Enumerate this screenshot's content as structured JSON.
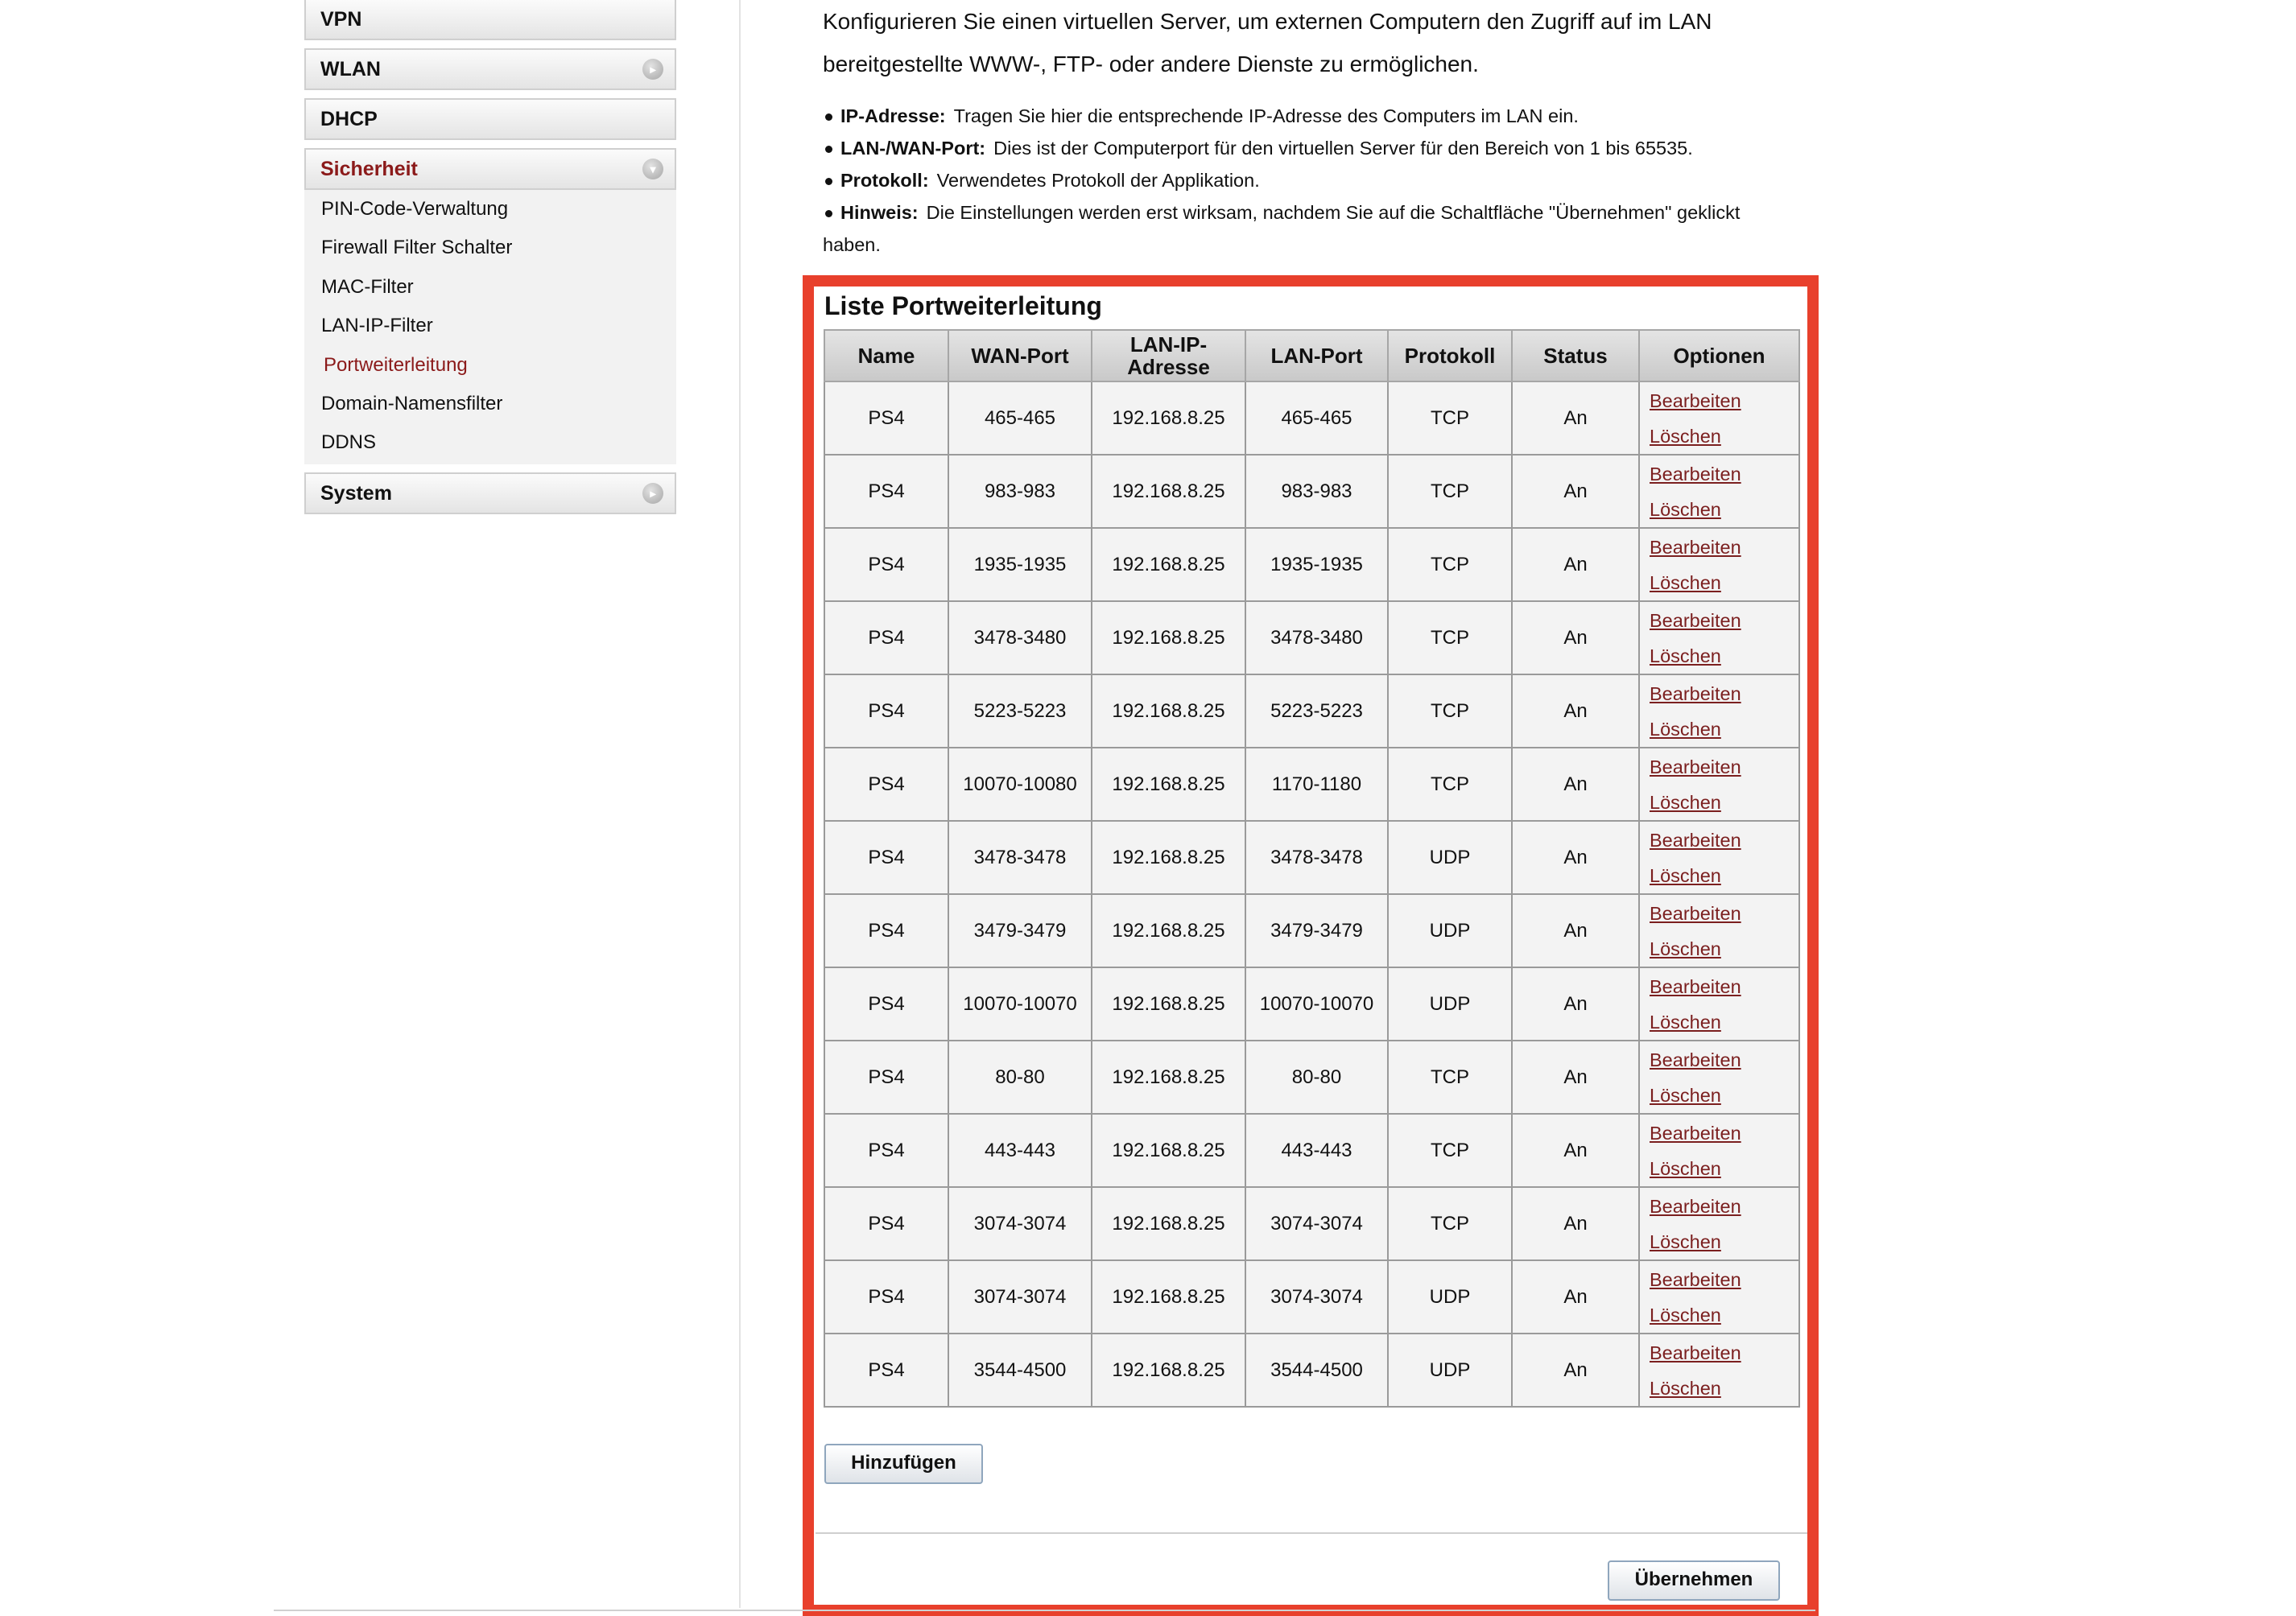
{
  "sidebar": {
    "sections": [
      {
        "label": "VPN"
      },
      {
        "label": "WLAN",
        "icon": "circle-chevron-right-icon"
      },
      {
        "label": "DHCP"
      },
      {
        "label": "Sicherheit",
        "icon": "circle-chevron-down-icon",
        "expanded": true,
        "items": [
          "PIN-Code-Verwaltung",
          "Firewall Filter Schalter",
          "MAC-Filter",
          "LAN-IP-Filter",
          "Portweiterleitung",
          "Domain-Namensfilter",
          "DDNS"
        ],
        "selected": "Portweiterleitung"
      },
      {
        "label": "System",
        "icon": "circle-chevron-right-icon"
      }
    ]
  },
  "intro": {
    "line1": "Konfigurieren Sie einen virtuellen Server, um externen Computern den Zugriff auf im LAN",
    "line2": "bereitgestellte WWW-, FTP- oder andere Dienste zu ermöglichen."
  },
  "bullets": [
    {
      "term": "IP-Adresse:",
      "text": "Tragen Sie hier die entsprechende IP-Adresse des Computers im LAN ein."
    },
    {
      "term": "LAN-/WAN-Port:",
      "text": "Dies ist der Computerport für den virtuellen Server für den Bereich von 1 bis 65535."
    },
    {
      "term": "Protokoll:",
      "text": "Verwendetes Protokoll der Applikation."
    },
    {
      "term": "Hinweis:",
      "text": "Die Einstellungen werden erst wirksam, nachdem Sie auf die Schaltfläche \"Übernehmen\" geklickt",
      "cont": "haben."
    }
  ],
  "list": {
    "title": "Liste Portweiterleitung",
    "headers": [
      "Name",
      "WAN-Port",
      "LAN-IP-Adresse",
      "LAN-Port",
      "Protokoll",
      "Status",
      "Optionen"
    ],
    "header_lan_ip_lines": [
      "LAN-IP-",
      "Adresse"
    ],
    "edit_label": "Bearbeiten",
    "delete_label": "Löschen",
    "rows": [
      [
        "PS4",
        "465-465",
        "192.168.8.25",
        "465-465",
        "TCP",
        "An"
      ],
      [
        "PS4",
        "983-983",
        "192.168.8.25",
        "983-983",
        "TCP",
        "An"
      ],
      [
        "PS4",
        "1935-1935",
        "192.168.8.25",
        "1935-1935",
        "TCP",
        "An"
      ],
      [
        "PS4",
        "3478-3480",
        "192.168.8.25",
        "3478-3480",
        "TCP",
        "An"
      ],
      [
        "PS4",
        "5223-5223",
        "192.168.8.25",
        "5223-5223",
        "TCP",
        "An"
      ],
      [
        "PS4",
        "10070-10080",
        "192.168.8.25",
        "1170-1180",
        "TCP",
        "An"
      ],
      [
        "PS4",
        "3478-3478",
        "192.168.8.25",
        "3478-3478",
        "UDP",
        "An"
      ],
      [
        "PS4",
        "3479-3479",
        "192.168.8.25",
        "3479-3479",
        "UDP",
        "An"
      ],
      [
        "PS4",
        "10070-10070",
        "192.168.8.25",
        "10070-10070",
        "UDP",
        "An"
      ],
      [
        "PS4",
        "80-80",
        "192.168.8.25",
        "80-80",
        "TCP",
        "An"
      ],
      [
        "PS4",
        "443-443",
        "192.168.8.25",
        "443-443",
        "TCP",
        "An"
      ],
      [
        "PS4",
        "3074-3074",
        "192.168.8.25",
        "3074-3074",
        "TCP",
        "An"
      ],
      [
        "PS4",
        "3074-3074",
        "192.168.8.25",
        "3074-3074",
        "UDP",
        "An"
      ],
      [
        "PS4",
        "3544-4500",
        "192.168.8.25",
        "3544-4500",
        "UDP",
        "An"
      ]
    ]
  },
  "buttons": {
    "add": "Hinzufügen",
    "apply": "Übernehmen"
  },
  "colors": {
    "highlight_border": "#e8402c",
    "active_link": "#8b1a1a"
  }
}
